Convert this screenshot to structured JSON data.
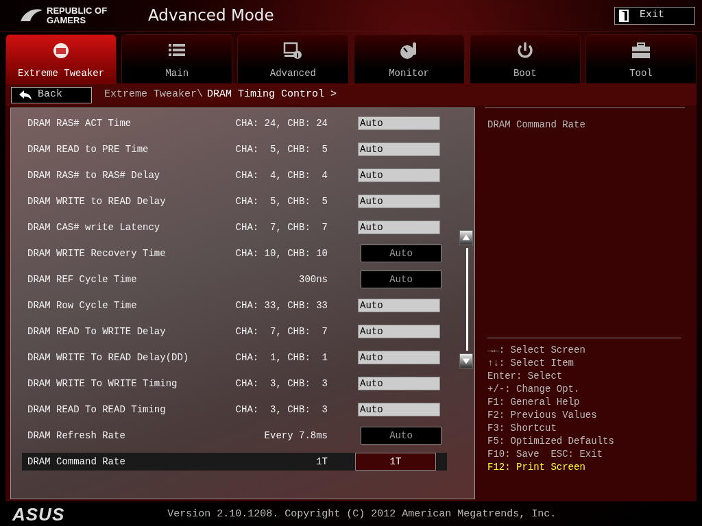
{
  "header": {
    "logo_text": "REPUBLIC OF GAMERS",
    "title": "Advanced Mode",
    "exit_button": "Exit"
  },
  "tabs": [
    {
      "label": "Extreme Tweaker",
      "selected": true
    },
    {
      "label": "Main",
      "selected": false
    },
    {
      "label": "Advanced",
      "selected": false
    },
    {
      "label": "Monitor",
      "selected": false
    },
    {
      "label": "Boot",
      "selected": false
    },
    {
      "label": "Tool",
      "selected": false
    }
  ],
  "back_button": "Back",
  "breadcrumb": {
    "parent": "Extreme Tweaker\\",
    "current": "DRAM Timing Control >"
  },
  "settings": [
    {
      "name": "DRAM RAS# ACT Time",
      "reading": "CHA: 24, CHB: 24",
      "value": "Auto",
      "kind": "field",
      "selected": false
    },
    {
      "name": "DRAM READ to PRE Time",
      "reading": "CHA:  5, CHB:  5",
      "value": "Auto",
      "kind": "field",
      "selected": false
    },
    {
      "name": "DRAM RAS# to RAS# Delay",
      "reading": "CHA:  4, CHB:  4",
      "value": "Auto",
      "kind": "field",
      "selected": false
    },
    {
      "name": "DRAM WRITE to READ Delay",
      "reading": "CHA:  5, CHB:  5",
      "value": "Auto",
      "kind": "field",
      "selected": false
    },
    {
      "name": "DRAM CAS# write Latency",
      "reading": "CHA:  7, CHB:  7",
      "value": "Auto",
      "kind": "field",
      "selected": false
    },
    {
      "name": "DRAM WRITE Recovery Time",
      "reading": "CHA: 10, CHB: 10",
      "value": "Auto",
      "kind": "option",
      "selected": false
    },
    {
      "name": "DRAM REF Cycle Time",
      "reading": "300ns",
      "value": "Auto",
      "kind": "option",
      "selected": false
    },
    {
      "name": "DRAM Row Cycle Time",
      "reading": "CHA: 33, CHB: 33",
      "value": "Auto",
      "kind": "field",
      "selected": false
    },
    {
      "name": "DRAM READ To WRITE Delay",
      "reading": "CHA:  7, CHB:  7",
      "value": "Auto",
      "kind": "field",
      "selected": false
    },
    {
      "name": "DRAM WRITE To READ Delay(DD)",
      "reading": "CHA:  1, CHB:  1",
      "value": "Auto",
      "kind": "field",
      "selected": false
    },
    {
      "name": "DRAM WRITE To WRITE Timing",
      "reading": "CHA:  3, CHB:  3",
      "value": "Auto",
      "kind": "field",
      "selected": false
    },
    {
      "name": "DRAM READ To READ Timing",
      "reading": "CHA:  3, CHB:  3",
      "value": "Auto",
      "kind": "field",
      "selected": false
    },
    {
      "name": "DRAM Refresh Rate",
      "reading": "Every 7.8ms",
      "value": "Auto",
      "kind": "option",
      "selected": false
    },
    {
      "name": "DRAM Command Rate",
      "reading": "1T",
      "value": "1T",
      "kind": "option",
      "selected": true
    }
  ],
  "help_title": "DRAM Command Rate",
  "key_help": [
    {
      "text": "→←: Select Screen",
      "highlighted": false
    },
    {
      "text": "↑↓: Select Item",
      "highlighted": false
    },
    {
      "text": "Enter: Select",
      "highlighted": false
    },
    {
      "text": "+/-: Change Opt.",
      "highlighted": false
    },
    {
      "text": "F1: General Help",
      "highlighted": false
    },
    {
      "text": "F2: Previous Values",
      "highlighted": false
    },
    {
      "text": "F3: Shortcut",
      "highlighted": false
    },
    {
      "text": "F5: Optimized Defaults",
      "highlighted": false
    },
    {
      "text": "F10: Save  ESC: Exit",
      "highlighted": false
    },
    {
      "text": "F12: Print Screen",
      "highlighted": true
    }
  ],
  "footer": {
    "brand": "ASUS",
    "version": "Version 2.10.1208. Copyright (C) 2012 American Megatrends, Inc."
  }
}
